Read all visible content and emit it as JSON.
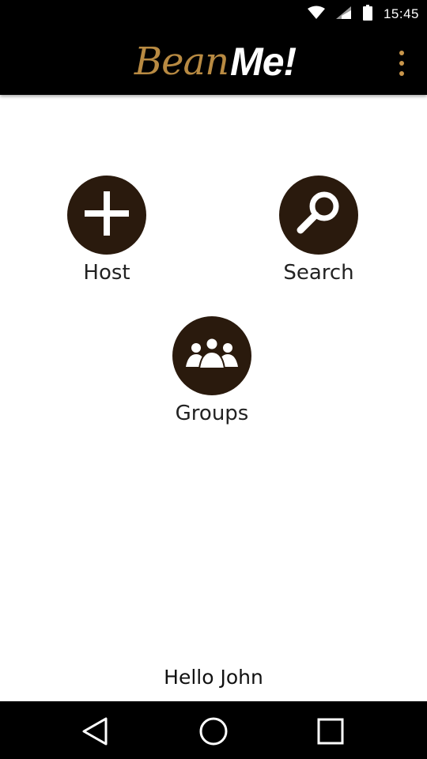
{
  "status_bar": {
    "time": "15:45"
  },
  "app_bar": {
    "logo_part1": "Bean",
    "logo_part2": "Me!"
  },
  "actions": {
    "host_label": "Host",
    "search_label": "Search",
    "groups_label": "Groups"
  },
  "greeting": "Hello John",
  "colors": {
    "bar_background": "#000000",
    "logo_accent": "#b88a42",
    "button_circle": "#2a1a0d",
    "menu_dots": "#c9964b"
  },
  "icons": [
    "wifi-icon",
    "signal-icon",
    "battery-icon",
    "overflow-menu-icon",
    "plus-icon",
    "search-icon",
    "groups-icon",
    "back-icon",
    "home-icon",
    "recents-icon"
  ]
}
